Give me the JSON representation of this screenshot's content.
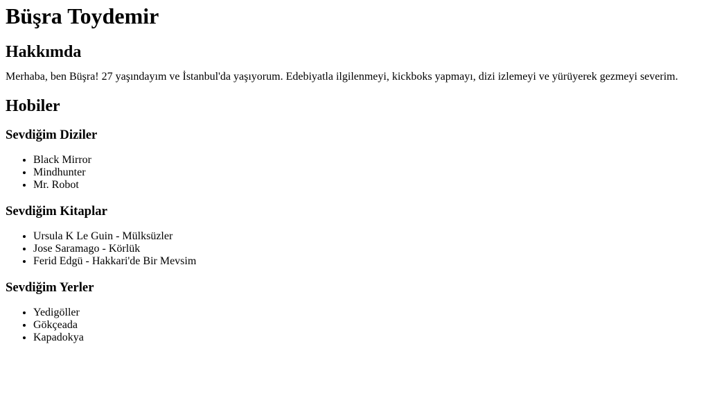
{
  "header": {
    "name": "Büşra Toydemir"
  },
  "about": {
    "title": "Hakkımda",
    "text": "Merhaba, ben Büşra! 27 yaşındayım ve İstanbul'da yaşıyorum. Edebiyatla ilgilenmeyi, kickboks yapmayı, dizi izlemeyi ve yürüyerek gezmeyi severim."
  },
  "hobbies": {
    "title": "Hobiler",
    "series": {
      "title": "Sevdiğim Diziler",
      "items": [
        "Black Mirror",
        "Mindhunter",
        "Mr. Robot"
      ]
    },
    "books": {
      "title": "Sevdiğim Kitaplar",
      "items": [
        "Ursula K Le Guin - Mülksüzler",
        "Jose Saramago - Körlük",
        "Ferid Edgü - Hakkari'de Bir Mevsim"
      ]
    },
    "places": {
      "title": "Sevdiğim Yerler",
      "items": [
        "Yedigöller",
        "Gökçeada",
        "Kapadokya"
      ]
    }
  }
}
